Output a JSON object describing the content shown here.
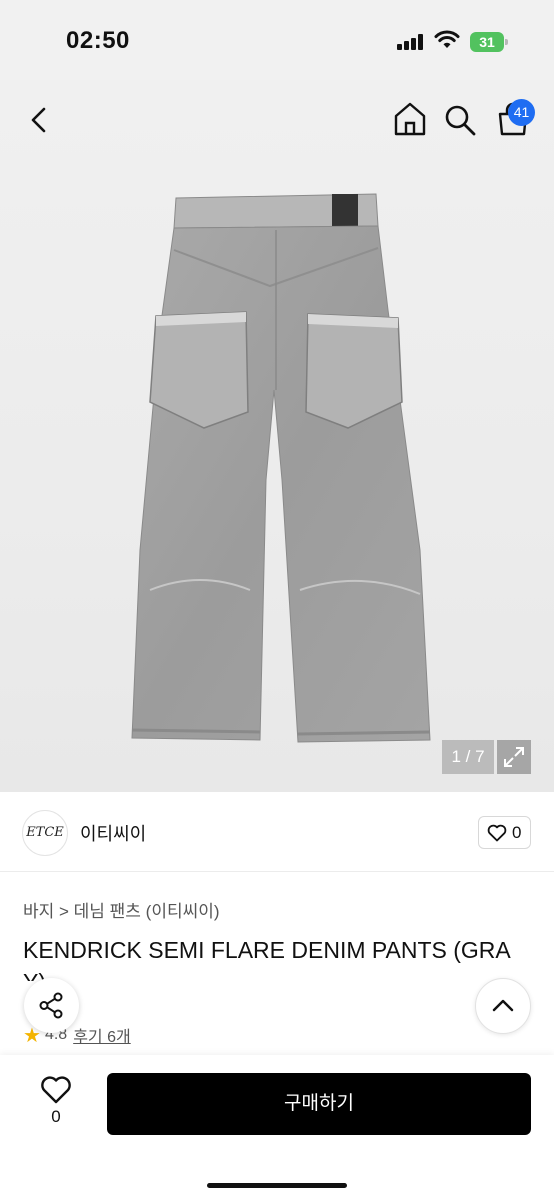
{
  "status_bar": {
    "time": "02:50",
    "battery_level": "31"
  },
  "nav": {
    "cart_count": "41"
  },
  "gallery": {
    "counter": "1 / 7"
  },
  "seller": {
    "logo_text": "ETCE",
    "name": "이티씨이",
    "like_count": "0"
  },
  "product": {
    "breadcrumb": "바지 > 데님 팬츠 (이티씨이)",
    "title": "KENDRICK SEMI FLARE DENIM PANTS (GRA",
    "title_overflow": "Y)",
    "rating": "4.8",
    "review_label": "후기 6개"
  },
  "bottom_bar": {
    "wish_count": "0",
    "buy_label": "구매하기"
  },
  "colors": {
    "accent_badge": "#1f6df2",
    "star": "#f4b400",
    "buy_button": "#000000"
  }
}
